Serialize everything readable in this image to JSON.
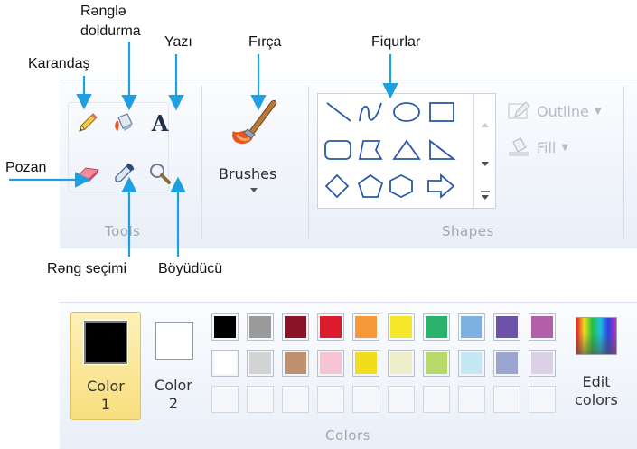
{
  "callouts": {
    "rengle": "Rənglə",
    "doldurma": "doldurma",
    "yazi": "Yazı",
    "firca": "Fırça",
    "fiqurlar": "Fiqurlar",
    "karandas": "Karandaş",
    "pozan": "Pozan",
    "reng_secimi": "Rəng seçimi",
    "boyuducu": "Böyüdücü"
  },
  "ribbon": {
    "tools_label": "Tools",
    "brushes_label": "Brushes",
    "shapes_label": "Shapes",
    "outline_label": "Outline",
    "fill_label": "Fill",
    "text_tool_glyph": "A"
  },
  "colors_panel": {
    "color1_label": "Color\n1",
    "color2_label": "Color\n2",
    "edit_colors_label": "Edit\ncolors",
    "group_label": "Colors",
    "color1_value": "#000000",
    "color2_value": "#ffffff",
    "palette_row1": [
      "#000000",
      "#9a9a9a",
      "#8a1426",
      "#dc1c2c",
      "#f7983a",
      "#f5e72a",
      "#2bb36b",
      "#7fb1e0",
      "#6c52a8",
      "#b25ea8"
    ],
    "palette_row2": [
      "#ffffff",
      "#d3d3d3",
      "#bf8f6e",
      "#f6c3d3",
      "#f2dc1b",
      "#eeefc8",
      "#b8d86a",
      "#c5e8f5",
      "#9aa6cf",
      "#dcd0e6"
    ],
    "palette_row3_empty_count": 10
  },
  "accent_colors": {
    "arrow": "#1e9fe0",
    "selected_bg": "#f8de7e"
  },
  "icons": [
    "pencil-icon",
    "fill-bucket-icon",
    "text-icon",
    "eraser-icon",
    "color-picker-icon",
    "magnifier-icon",
    "brush-icon",
    "line-shape",
    "curve-shape",
    "oval-shape",
    "rectangle-shape",
    "rounded-rectangle-shape",
    "polygon-shape",
    "triangle-shape",
    "right-triangle-shape",
    "diamond-shape",
    "pentagon-shape",
    "hexagon-shape",
    "right-arrow-shape"
  ]
}
